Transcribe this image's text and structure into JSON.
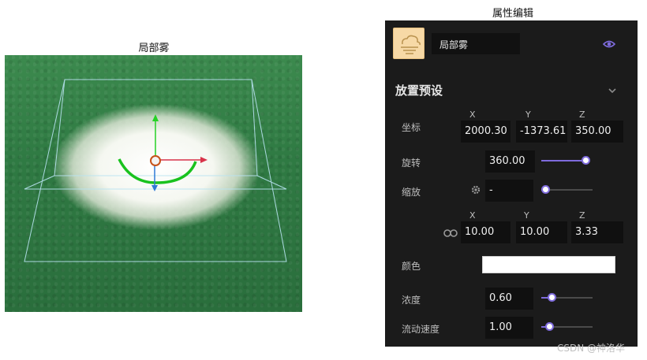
{
  "scene": {
    "title": "局部雾"
  },
  "panel": {
    "title": "属性编辑",
    "name_value": "局部雾",
    "section_title": "放置预设",
    "axis_labels": [
      "X",
      "Y",
      "Z"
    ],
    "position": {
      "label": "坐标",
      "x": "2000.30",
      "y": "-1373.61",
      "z": "350.00"
    },
    "rotation": {
      "label": "旋转",
      "value": "360.00",
      "slider_fraction": 1.0
    },
    "scale": {
      "label": "缩放",
      "value": "-",
      "slider_fraction": 0.0,
      "x": "10.00",
      "y": "10.00",
      "z": "3.33"
    },
    "color": {
      "label": "颜色",
      "value": "#ffffff"
    },
    "density": {
      "label": "浓度",
      "value": "0.60",
      "slider_fraction": 0.15
    },
    "flow_speed": {
      "label": "流动速度",
      "value": "1.00",
      "slider_fraction": 0.1
    }
  },
  "watermark": "CSDN @神洛华",
  "colors": {
    "accent": "#7e6bdc",
    "panel_bg": "#1b1b1b",
    "thumb_bg": "#f7d9a6"
  },
  "icons": [
    "cloud-fog-icon",
    "eye-icon",
    "chevron-down-icon",
    "gear-icon",
    "link-icon"
  ]
}
